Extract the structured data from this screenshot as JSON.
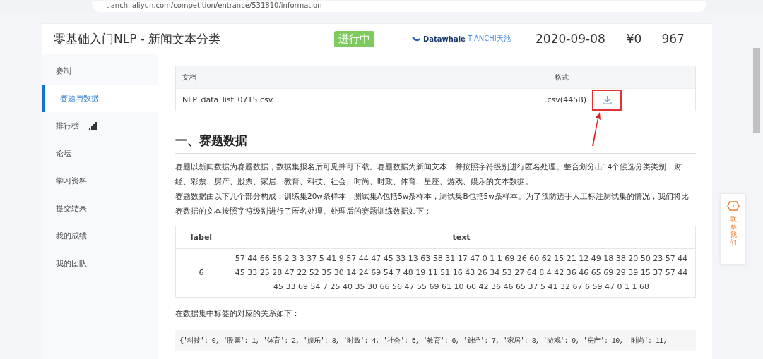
{
  "browser": {
    "url": "tianchi.aliyun.com/competition/entrance/531810/information"
  },
  "header": {
    "title": "零基础入门NLP - 新闻文本分类",
    "status": "进行中",
    "logo_text": "Datawhale",
    "logo_brand": "TIANCHI天池",
    "date": "2020-09-08",
    "prize": "¥0",
    "participants": "967"
  },
  "sidebar": {
    "items": [
      {
        "label": "赛制",
        "selected": false
      },
      {
        "label": "赛题与数据",
        "selected": true
      },
      {
        "label": "排行榜",
        "selected": false,
        "kind": "chart"
      },
      {
        "label": "论坛",
        "selected": false
      },
      {
        "label": "学习资料",
        "selected": false
      },
      {
        "label": "提交结果",
        "selected": false
      },
      {
        "label": "我的成绩",
        "selected": false
      },
      {
        "label": "我的团队",
        "selected": false
      }
    ]
  },
  "files": {
    "columns": [
      "文档",
      "格式"
    ],
    "rows": [
      {
        "name": "NLP_data_list_0715.csv",
        "format": ".csv(445B)",
        "highlighted": true
      }
    ]
  },
  "section_title": "一、赛题数据",
  "paragraphs": [
    "赛题以新闻数据为赛题数据，数据集报名后可见并可下载。赛题数据为新闻文本，并按照字符级别进行匿名处理。整合划分出14个候选分类类别：财经、彩票、房产、股票、家居、教育、科技、社会、时尚、时政、体育、星座、游戏、娱乐的文本数据。",
    "赛题数据由以下几个部分构成：训练集20w条样本，测试集A包括5w条样本，测试集B包括5w条样本。为了预防选手人工标注测试集的情况，我们将比赛数据的文本按照字符级别进行了匿名处理。处理后的赛题训练数据如下："
  ],
  "sample": {
    "columns": [
      "label",
      "text"
    ],
    "rows": [
      [
        "6",
        "57 44 66 56 2 3 3 37 5 41 9 57 44 47 45 33 13 63 58 31 17 47 0 1 1 69 26 60 62 15 21 12 49 18 38 20 50 23 57 44 45 33 25 28 47 22 52 35 30 14 24 69 54 7 48 19 11 51 16 43 26 34 53 27 64 8 4 42 36 46 65 69 29 39 15 37 57 44 45 33 69 54 7 25 40 35 30 66 56 47 55 69 61 10 60 42 36 46 65 37 5 41 32 67 6 59 47 0 1 1 68"
      ]
    ]
  },
  "mapping_intro": "在数据集中标签的对应的关系如下：",
  "code": "{'科技': 0, '股票': 1, '体育': 2, '娱乐': 3, '时政': 4, '社会': 5, '教育': 6, '财经': 7, '家居': 8, '游戏': 9, '房产': 10, '时尚': 11, ",
  "contact": {
    "label": "联系我们"
  }
}
